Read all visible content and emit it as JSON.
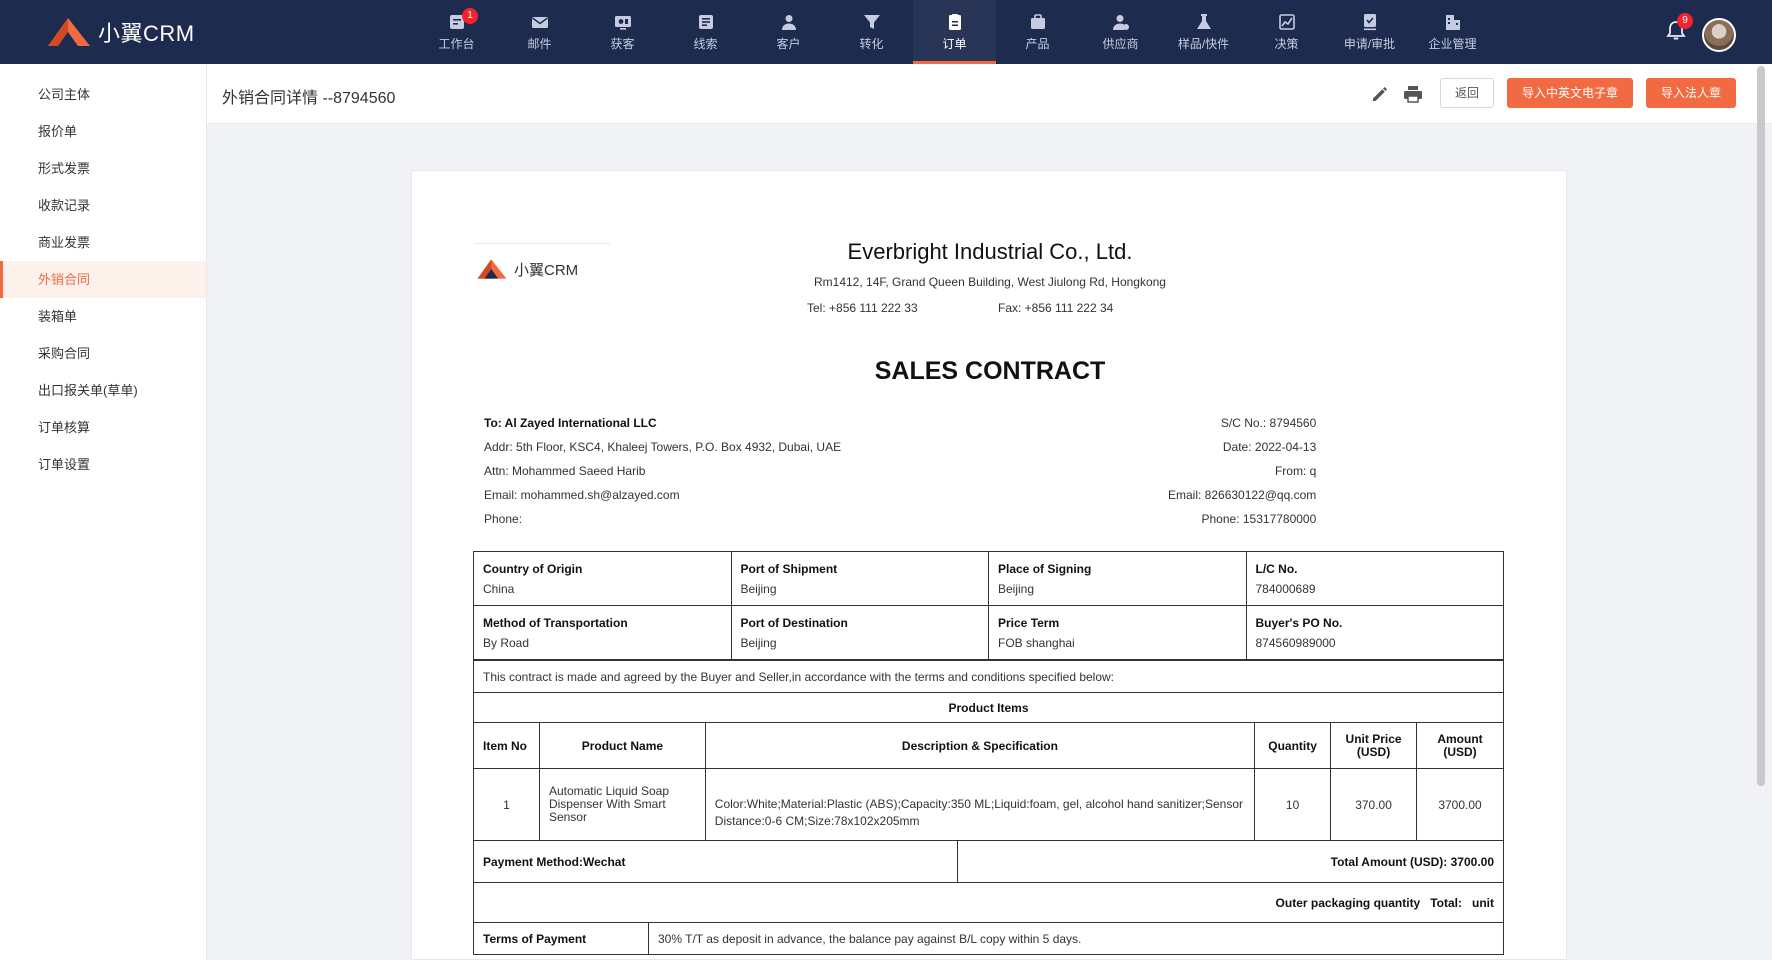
{
  "nav": {
    "logo_text": "小翼CRM",
    "items": [
      {
        "label": "工作台",
        "icon": "dashboard-icon",
        "badge": "1"
      },
      {
        "label": "邮件",
        "icon": "mail-icon"
      },
      {
        "label": "获客",
        "icon": "acquire-icon"
      },
      {
        "label": "线索",
        "icon": "clue-icon"
      },
      {
        "label": "客户",
        "icon": "customer-icon"
      },
      {
        "label": "转化",
        "icon": "funnel-icon"
      },
      {
        "label": "订单",
        "icon": "order-icon",
        "active": true
      },
      {
        "label": "产品",
        "icon": "product-icon"
      },
      {
        "label": "供应商",
        "icon": "supplier-icon"
      },
      {
        "label": "样品/快件",
        "icon": "flask-icon"
      },
      {
        "label": "决策",
        "icon": "chart-icon"
      },
      {
        "label": "申请/审批",
        "icon": "approve-icon"
      },
      {
        "label": "企业管理",
        "icon": "building-icon"
      }
    ],
    "bell_badge": "9"
  },
  "sidebar": {
    "items": [
      {
        "label": "公司主体"
      },
      {
        "label": "报价单"
      },
      {
        "label": "形式发票"
      },
      {
        "label": "收款记录"
      },
      {
        "label": "商业发票"
      },
      {
        "label": "外销合同",
        "active": true
      },
      {
        "label": "装箱单"
      },
      {
        "label": "采购合同"
      },
      {
        "label": "出口报关单(草单)"
      },
      {
        "label": "订单核算"
      },
      {
        "label": "订单设置"
      }
    ]
  },
  "header": {
    "title": "外销合同详情 --8794560",
    "back_label": "返回",
    "import_cn_en_seal_label": "导入中英文电子章",
    "import_legal_seal_label": "导入法人章"
  },
  "document": {
    "logo_text": "小翼CRM",
    "company_name": "Everbright Industrial Co., Ltd.",
    "company_address": "Rm1412, 14F, Grand Queen Building, West Jiulong Rd, Hongkong",
    "company_tel": "Tel: +856 111 222 33",
    "company_fax": "Fax: +856 111 222 34",
    "title": "SALES CONTRACT",
    "buyer": {
      "to": "To: Al Zayed International LLC",
      "addr": "Addr: 5th Floor, KSC4, Khaleej Towers, P.O. Box 4932, Dubai, UAE",
      "attn": "Attn: Mohammed Saeed Harib",
      "email": "Email: mohammed.sh@alzayed.com",
      "phone": "Phone:"
    },
    "seller": {
      "sc_no": "S/C No.: 8794560",
      "date": "Date: 2022-04-13",
      "from": "From: q",
      "email": "Email: 826630122@qq.com",
      "phone": "Phone: 15317780000"
    },
    "info_grid": [
      [
        {
          "key": "Country of Origin",
          "value": "China"
        },
        {
          "key": "Port of Shipment",
          "value": "Beijing"
        },
        {
          "key": "Place of Signing",
          "value": "Beijing"
        },
        {
          "key": "L/C No.",
          "value": "784000689"
        }
      ],
      [
        {
          "key": "Method of Transportation",
          "value": "By Road"
        },
        {
          "key": "Port of Destination",
          "value": "Beijing"
        },
        {
          "key": "Price Term",
          "value": "FOB shanghai"
        },
        {
          "key": "Buyer's PO No.",
          "value": "874560989000"
        }
      ]
    ],
    "agreement_text": "This contract is made and agreed by the Buyer and Seller,in accordance with the terms and conditions specified below:",
    "product_items_title": "Product Items",
    "items_columns": [
      "Item No",
      "Product Name",
      "Description & Specification",
      "Quantity",
      "Unit Price (USD)",
      "Amount (USD)"
    ],
    "items": [
      {
        "no": "1",
        "name": "Automatic Liquid Soap Dispenser With Smart Sensor",
        "desc": "Color:White;Material:Plastic (ABS);Capacity:350 ML;Liquid:foam, gel, alcohol hand sanitizer;Sensor Distance:0-6 CM;Size:78x102x205mm",
        "qty": "10",
        "unit_price": "370.00",
        "amount": "3700.00"
      }
    ],
    "payment_method": "Payment Method:Wechat",
    "total_amount": "Total Amount (USD): 3700.00",
    "outer_packaging": "Outer packaging quantity   Total:   unit",
    "terms_label": "Terms of Payment",
    "terms_value": "30% T/T as deposit in advance, the balance pay against B/L copy within 5 days."
  }
}
